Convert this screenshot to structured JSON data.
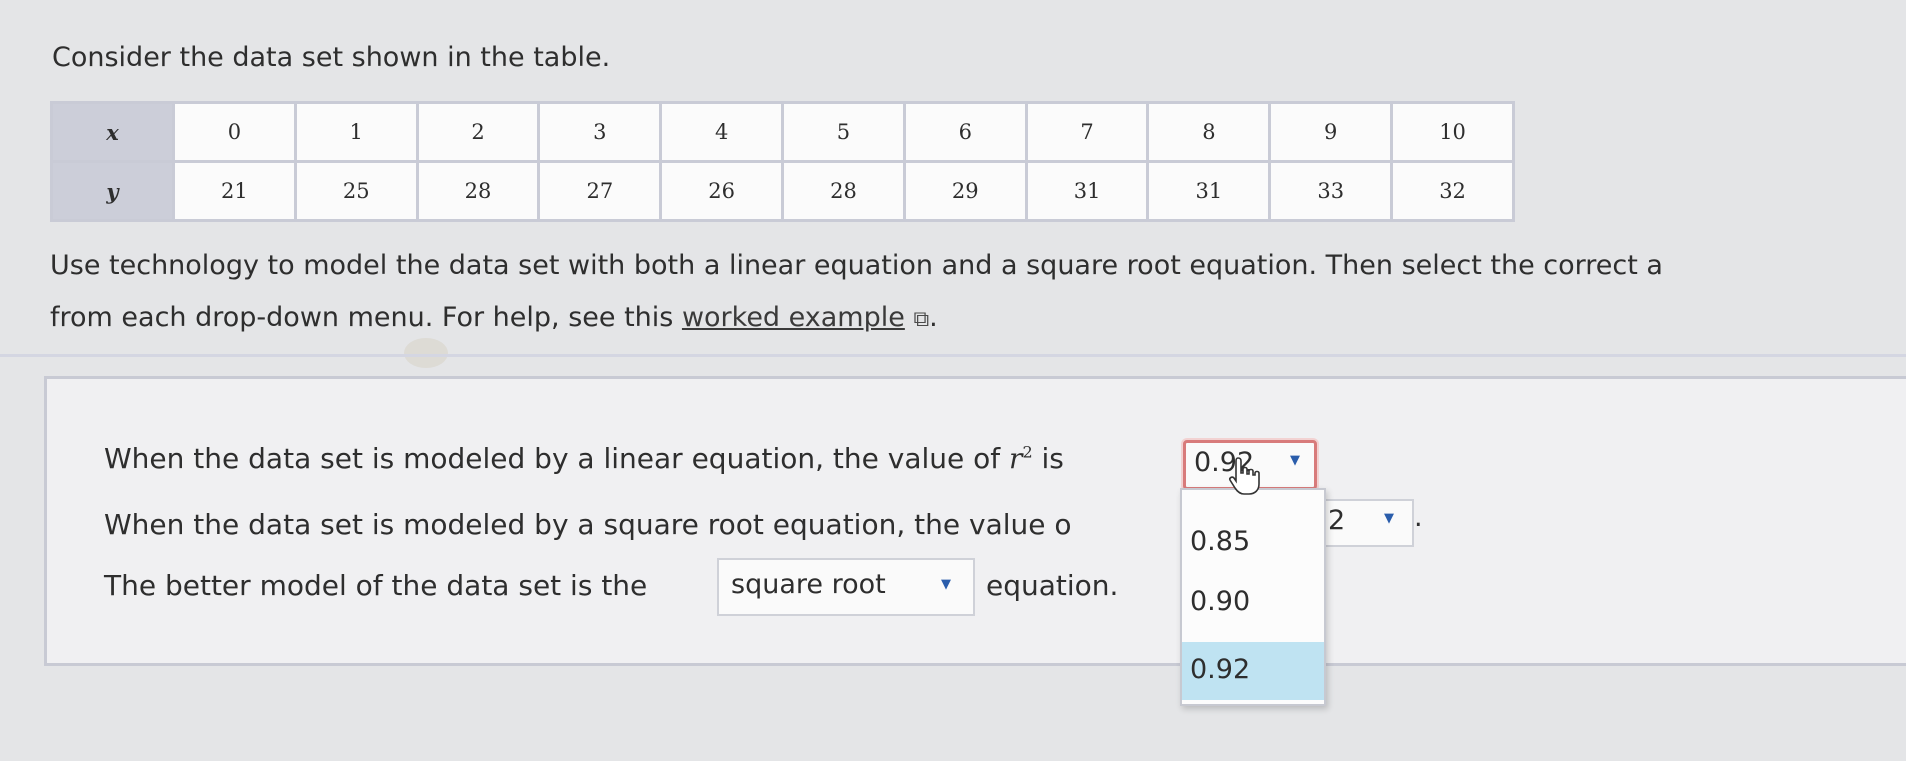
{
  "intro": "Consider the data set shown in the table.",
  "table": {
    "x_label": "x",
    "y_label": "y",
    "x": [
      "0",
      "1",
      "2",
      "3",
      "4",
      "5",
      "6",
      "7",
      "8",
      "9",
      "10"
    ],
    "y": [
      "21",
      "25",
      "28",
      "27",
      "26",
      "28",
      "29",
      "31",
      "31",
      "33",
      "32"
    ]
  },
  "instructions": {
    "line1": "Use technology to model the data set with both a linear equation and a square root equation. Then select the correct a",
    "line2_prefix": "from each drop-down menu. For help, see this",
    "link_text": "worked example",
    "link_suffix": "."
  },
  "question1": {
    "prefix": "When the data set is modeled by a linear equation, the value of",
    "r_symbol": "r",
    "r_exponent": "2",
    "suffix": "is",
    "dropdown_value": "0.92"
  },
  "question2": {
    "prefix": "When the data set is modeled by a square root equation, the value o",
    "dropdown_value": "2",
    "suffix": "."
  },
  "question3": {
    "prefix": "The better model of the data set is the",
    "dropdown_value": "square root",
    "suffix": "equation."
  },
  "dropdown_menu": {
    "options": [
      "0.85",
      "0.90",
      "0.92"
    ],
    "selected_index": 2
  },
  "icons": {
    "dropdown_arrow": "▼",
    "external_link": "⧉"
  }
}
